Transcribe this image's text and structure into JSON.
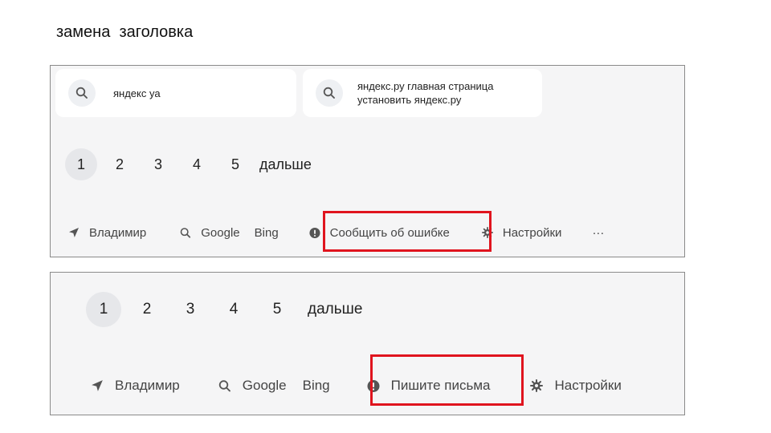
{
  "slide": {
    "title": "замена  заголовка"
  },
  "top_screenshot": {
    "suggestions": [
      {
        "icon": "search-icon",
        "lines": [
          "яндекс уа"
        ]
      },
      {
        "icon": "search-icon",
        "lines": [
          "яндекс.ру главная страница",
          "установить яндекс.ру"
        ]
      }
    ],
    "pager": {
      "pages": [
        "1",
        "2",
        "3",
        "4",
        "5"
      ],
      "current": "1",
      "next_label": "дальше"
    },
    "footer": {
      "location": "Владимир",
      "google": "Google",
      "bing": "Bing",
      "report_label": "Сообщить об ошибке",
      "settings": "Настройки",
      "more": "···"
    }
  },
  "bottom_screenshot": {
    "pager": {
      "pages": [
        "1",
        "2",
        "3",
        "4",
        "5"
      ],
      "current": "1",
      "next_label": "дальше"
    },
    "footer": {
      "location": "Владимир",
      "google": "Google",
      "bing": "Bing",
      "report_label": "Пишите письма",
      "settings": "Настройки"
    }
  },
  "colors": {
    "highlight": "#e0141e",
    "panel_bg": "#f5f5f6",
    "icon": "#4d4d4d"
  }
}
